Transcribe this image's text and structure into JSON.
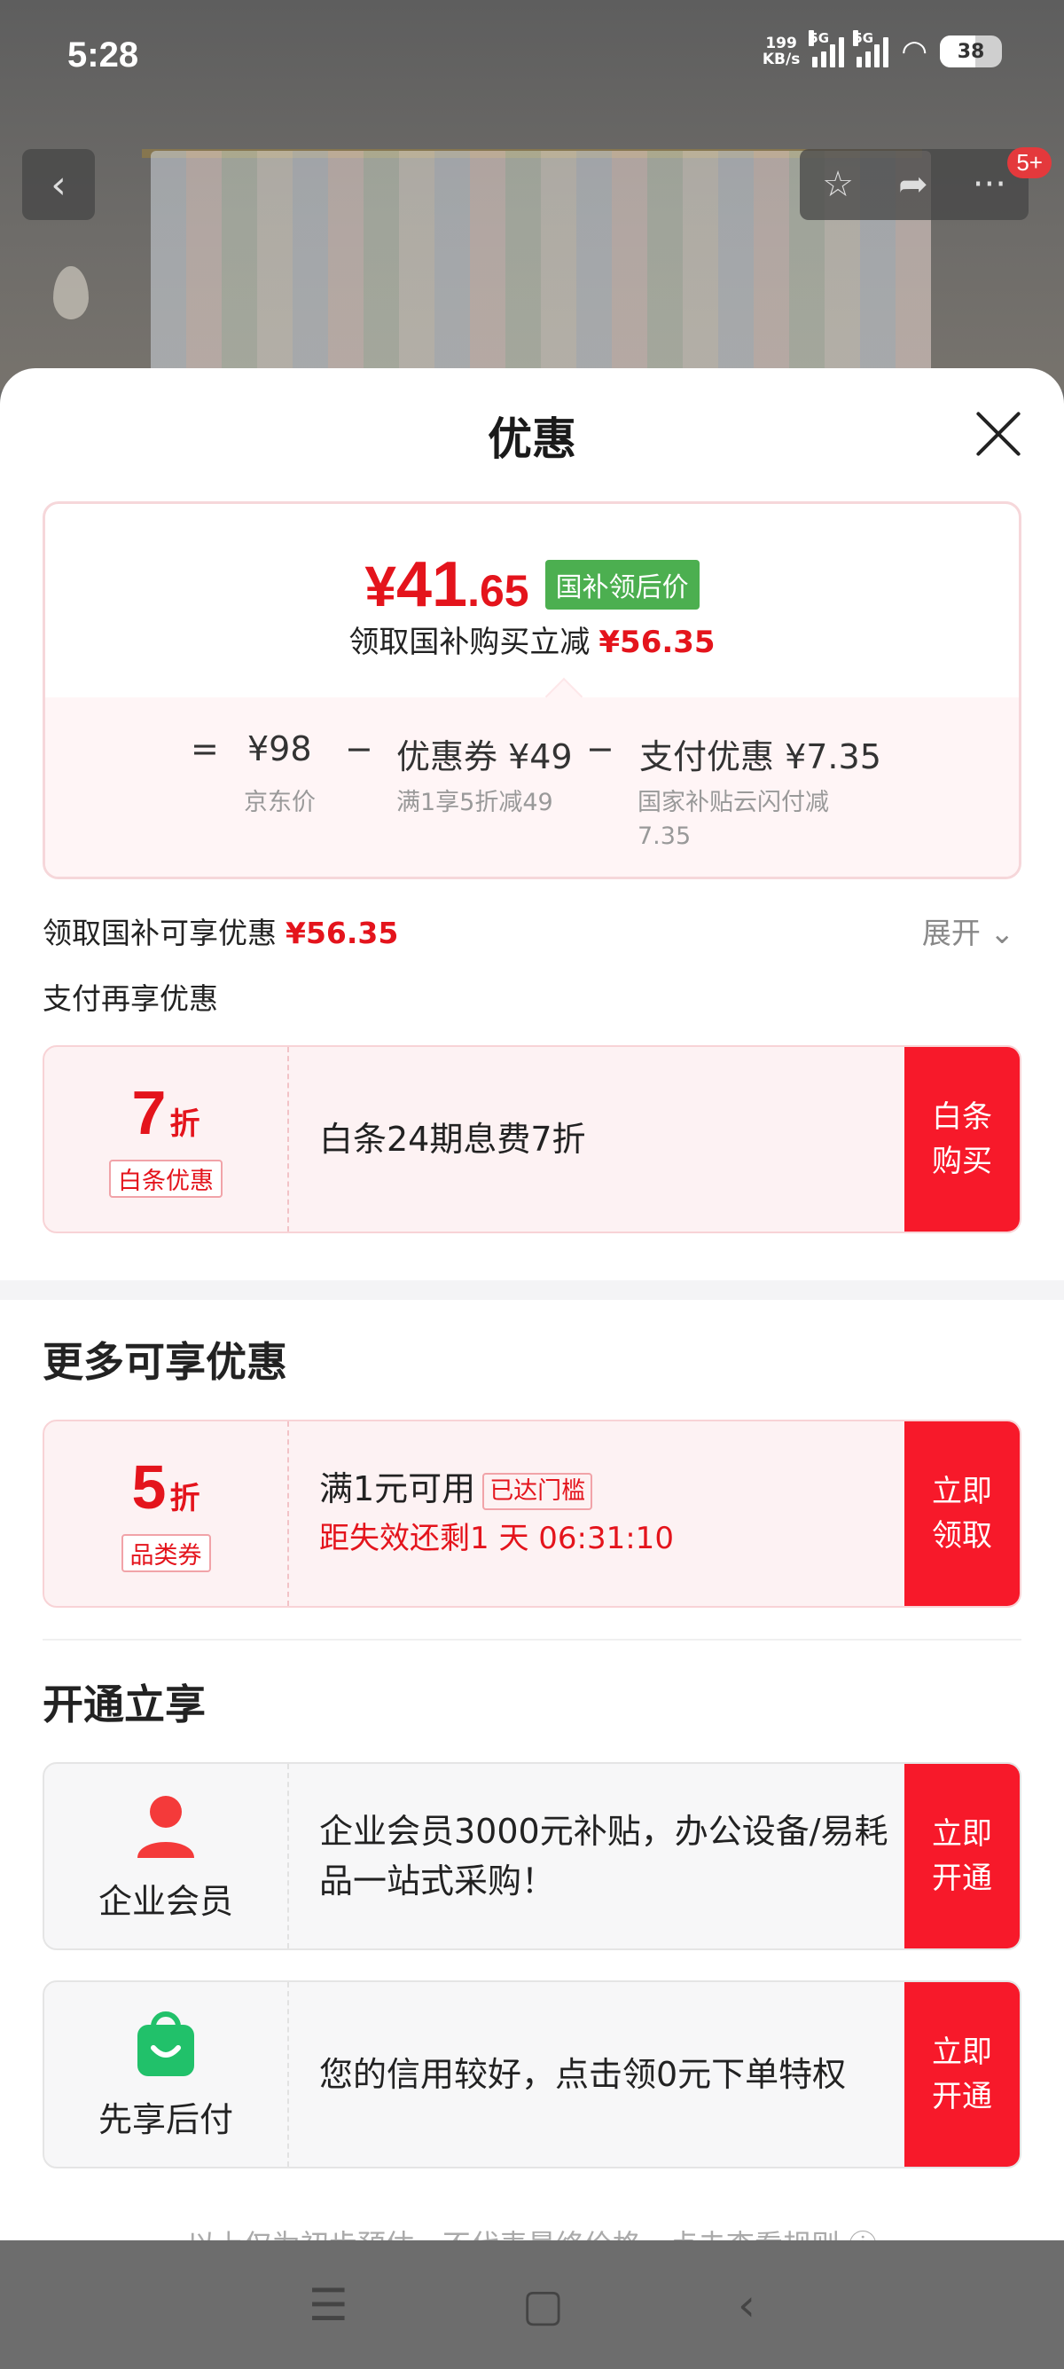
{
  "status_bar": {
    "time": "5:28",
    "speed_value": "199",
    "speed_unit": "KB/s",
    "sim1": "5G",
    "sim2": "5G",
    "battery": "38"
  },
  "top_actions": {
    "back": "‹",
    "favorite": "☆",
    "share": "➦",
    "more": "···",
    "badge": "5+"
  },
  "sheet": {
    "title": "优惠",
    "price": {
      "yen": "¥",
      "int": "41",
      "dec": ".65",
      "tag": "国补领后价",
      "subtitle": "领取国补购买立减",
      "subtitle_amount": "¥56.35"
    },
    "calc": {
      "eq": "=",
      "base": "¥98",
      "base_label": "京东价",
      "minus1": "−",
      "coupon": "优惠券 ¥49",
      "coupon_label": "满1享5折减49",
      "minus2": "−",
      "pay": "支付优惠 ¥7.35",
      "pay_label": "国家补贴云闪付减7.35"
    },
    "subsidy_line": "领取国补可享优惠",
    "subsidy_amount": "¥56.35",
    "expand": "展开",
    "pay_more": "支付再享优惠",
    "baitiao": {
      "discount": "7",
      "unit": "折",
      "tag": "白条优惠",
      "desc": "白条24期息费7折",
      "button": "白条购买"
    },
    "more_title": "更多可享优惠",
    "category_coupon": {
      "discount": "5",
      "unit": "折",
      "tag": "品类券",
      "condition": "满1元可用",
      "reached": "已达门槛",
      "countdown": "距失效还剩1 天 06:31:10",
      "button": "立即领取"
    },
    "open_title": "开通立享",
    "enterprise": {
      "label": "企业会员",
      "desc": "企业会员3000元补贴，办公设备/易耗品一站式采购！",
      "button": "立即开通"
    },
    "pay_later": {
      "label": "先享后付",
      "desc": "您的信用较好，点击领0元下单特权",
      "button": "立即开通"
    },
    "footer_hint": "以上仅为初步预估，不代表最终价格，点击查看规则 ⓘ"
  },
  "navbar": {
    "menu": "☰",
    "home": "▢",
    "back": "‹"
  }
}
